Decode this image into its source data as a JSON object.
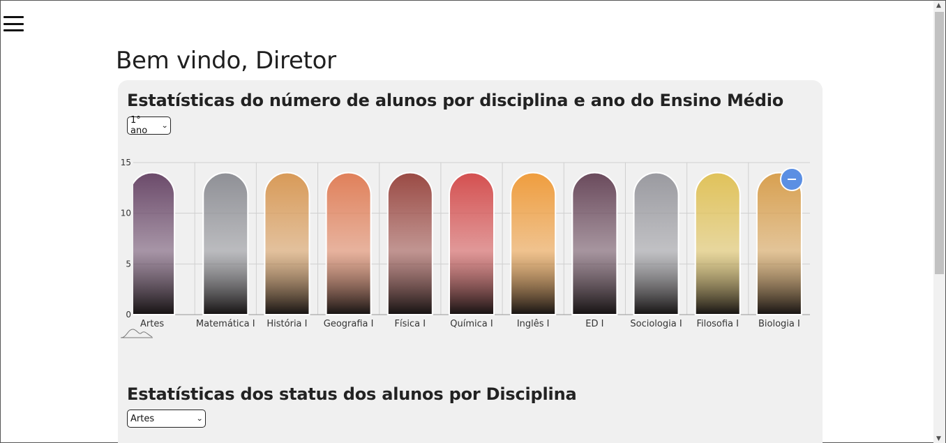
{
  "header": {
    "title": "Bem vindo, Diretor"
  },
  "section1": {
    "title": "Estatísticas do número de alunos por disciplina e ano do Ensino Médio",
    "year_select": "1° ano"
  },
  "section2": {
    "title": "Estatísticas dos status dos alunos por Disciplina",
    "subject_select": "Artes"
  },
  "chart_data": {
    "type": "bar",
    "categories": [
      "Artes",
      "Matemática I",
      "História I",
      "Geografia I",
      "Física I",
      "Química I",
      "Inglês I",
      "ED I",
      "Sociologia I",
      "Filosofia I",
      "Biologia I"
    ],
    "values": [
      14,
      14,
      14,
      14,
      14,
      14,
      14,
      14,
      14,
      14,
      14
    ],
    "ylim": [
      0,
      15
    ],
    "yticks": [
      0,
      5,
      10,
      15
    ],
    "grid": true,
    "colors": [
      "#6b4a6a",
      "#8f9096",
      "#d89a58",
      "#e0805a",
      "#9a4a44",
      "#d45050",
      "#ef9d3e",
      "#6a4a5c",
      "#9a9aa0",
      "#e0c25a",
      "#d8a050"
    ]
  },
  "zoom_button": {
    "icon": "minus-icon"
  }
}
